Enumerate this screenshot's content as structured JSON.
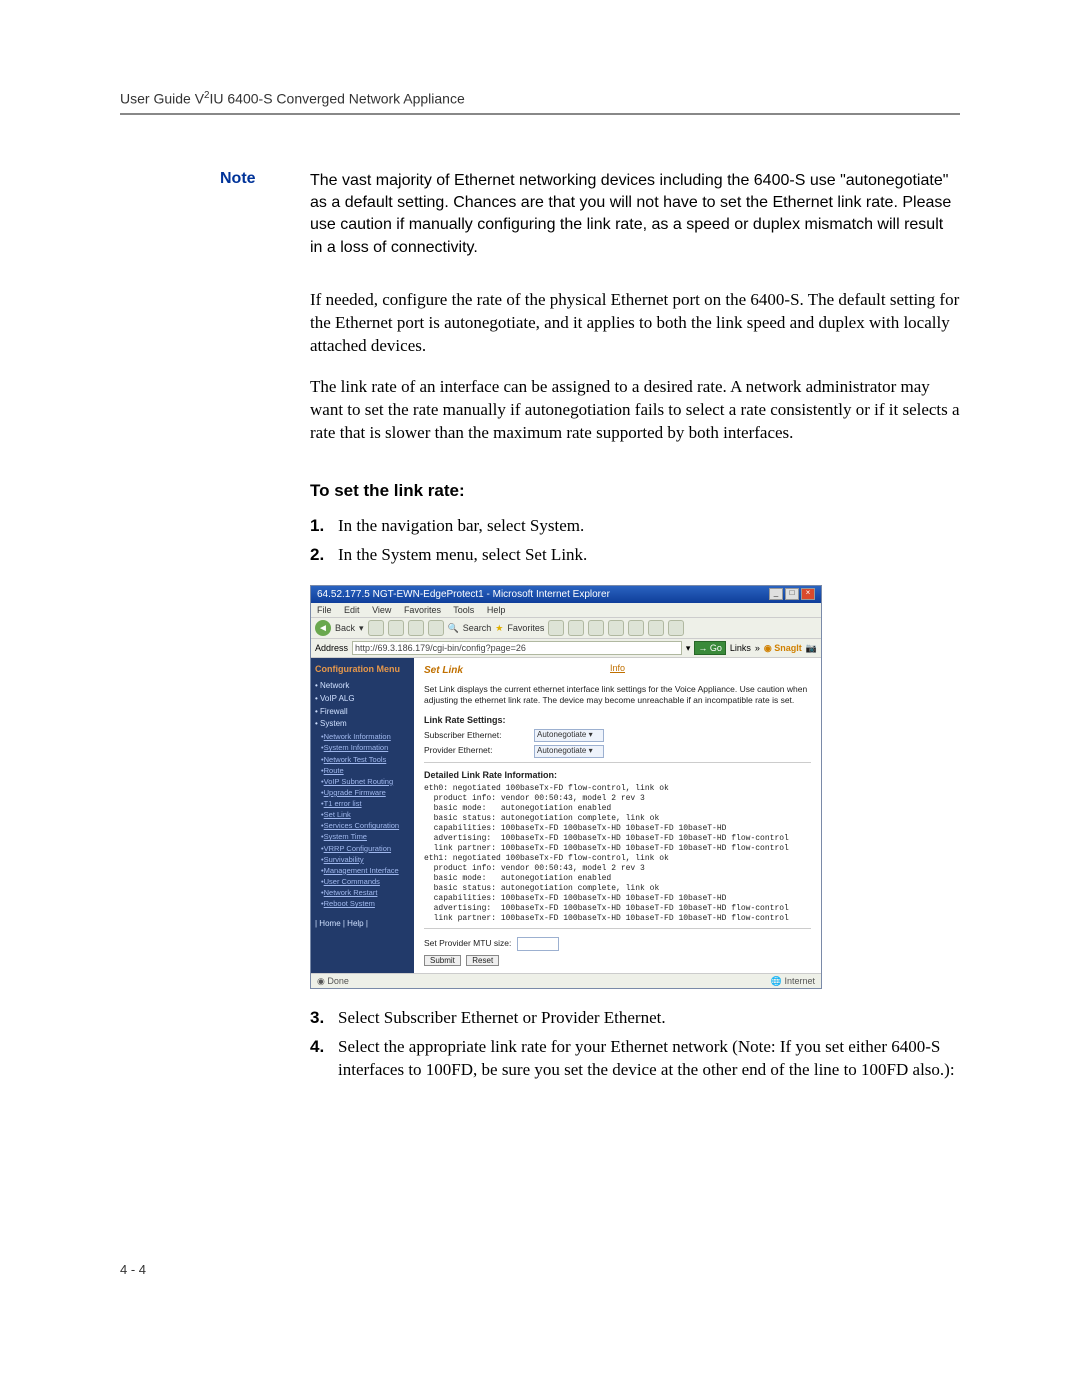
{
  "header": "User Guide V²IU 6400-S Converged Network Appliance",
  "note_label": "Note",
  "note_text": "The vast majority of Ethernet networking devices including the 6400-S use \"autonegotiate\" as a default setting. Chances are that you will not have to set the Ethernet link rate. Please use caution if manually configuring the link rate, as a speed or duplex mismatch will result in a loss of connectivity.",
  "para1": "If needed, configure the rate of the physical Ethernet port on the 6400-S. The default setting for the Ethernet port is autonegotiate, and it applies to both the link speed and duplex with locally attached devices.",
  "para2": "The link rate of an interface can be assigned to a desired rate. A network administrator may want to set the rate manually if autonegotiation fails to select a rate consistently or if it selects a rate that is slower than the maximum rate supported by both interfaces.",
  "subhead": "To set the link rate:",
  "steps": [
    "In the navigation bar, select System.",
    "In the System menu, select Set Link.",
    "Select Subscriber Ethernet or Provider Ethernet.",
    "Select the appropriate link rate for your Ethernet network (Note: If you set either 6400-S interfaces to 100FD, be sure you set the device at the other end of the line to 100FD also.):"
  ],
  "page_num": "4 - 4",
  "shot": {
    "title": "64.52.177.5 NGT-EWN-EdgeProtect1 - Microsoft Internet Explorer",
    "menubar": [
      "File",
      "Edit",
      "View",
      "Favorites",
      "Tools",
      "Help"
    ],
    "back": "Back",
    "search": "Search",
    "favorites": "Favorites",
    "addr_label": "Address",
    "url": "http://69.3.186.179/cgi-bin/config?page=26",
    "go": "Go",
    "links": "Links",
    "snagit": "SnagIt",
    "sidebar_title": "Configuration Menu",
    "sb_top": [
      "Network",
      "VoIP ALG",
      "Firewall",
      "System"
    ],
    "sb_sys": [
      "Network Information",
      "System Information",
      "Network Test Tools",
      "Route",
      "VoIP Subnet Routing",
      "Upgrade Firmware",
      "T1 error list",
      "Set Link",
      "Services Configuration",
      "System Time",
      "VRRP Configuration",
      "Survivability",
      "Management Interface",
      "User Commands",
      "Network Restart",
      "Reboot System"
    ],
    "sb_home": "| Home | Help |",
    "info": "Info",
    "h4": "Set Link",
    "desc": "Set Link displays the current ethernet interface link settings for the Voice Appliance. Use caution when adjusting the ethernet link rate. The device may become unreachable if an incompatible rate is set.",
    "sec1": "Link Rate Settings:",
    "sub_eth": "Subscriber Ethernet:",
    "prov_eth": "Provider Ethernet:",
    "auto": "Autonegotiate",
    "sec2": "Detailed Link Rate Information:",
    "mono": "eth0: negotiated 100baseTx-FD flow-control, link ok\n  product info: vendor 00:50:43, model 2 rev 3\n  basic mode:   autonegotiation enabled\n  basic status: autonegotiation complete, link ok\n  capabilities: 100baseTx-FD 100baseTx-HD 10baseT-FD 10baseT-HD\n  advertising:  100baseTx-FD 100baseTx-HD 10baseT-FD 10baseT-HD flow-control\n  link partner: 100baseTx-FD 100baseTx-HD 10baseT-FD 10baseT-HD flow-control\neth1: negotiated 100baseTx-FD flow-control, link ok\n  product info: vendor 00:50:43, model 2 rev 3\n  basic mode:   autonegotiation enabled\n  basic status: autonegotiation complete, link ok\n  capabilities: 100baseTx-FD 100baseTx-HD 10baseT-FD 10baseT-HD\n  advertising:  100baseTx-FD 100baseTx-HD 10baseT-FD 10baseT-HD flow-control\n  link partner: 100baseTx-FD 100baseTx-HD 10baseT-FD 10baseT-HD flow-control",
    "mtu_label": "Set Provider MTU size:",
    "submit": "Submit",
    "reset": "Reset",
    "status_left": "Done",
    "status_right": "Internet"
  }
}
